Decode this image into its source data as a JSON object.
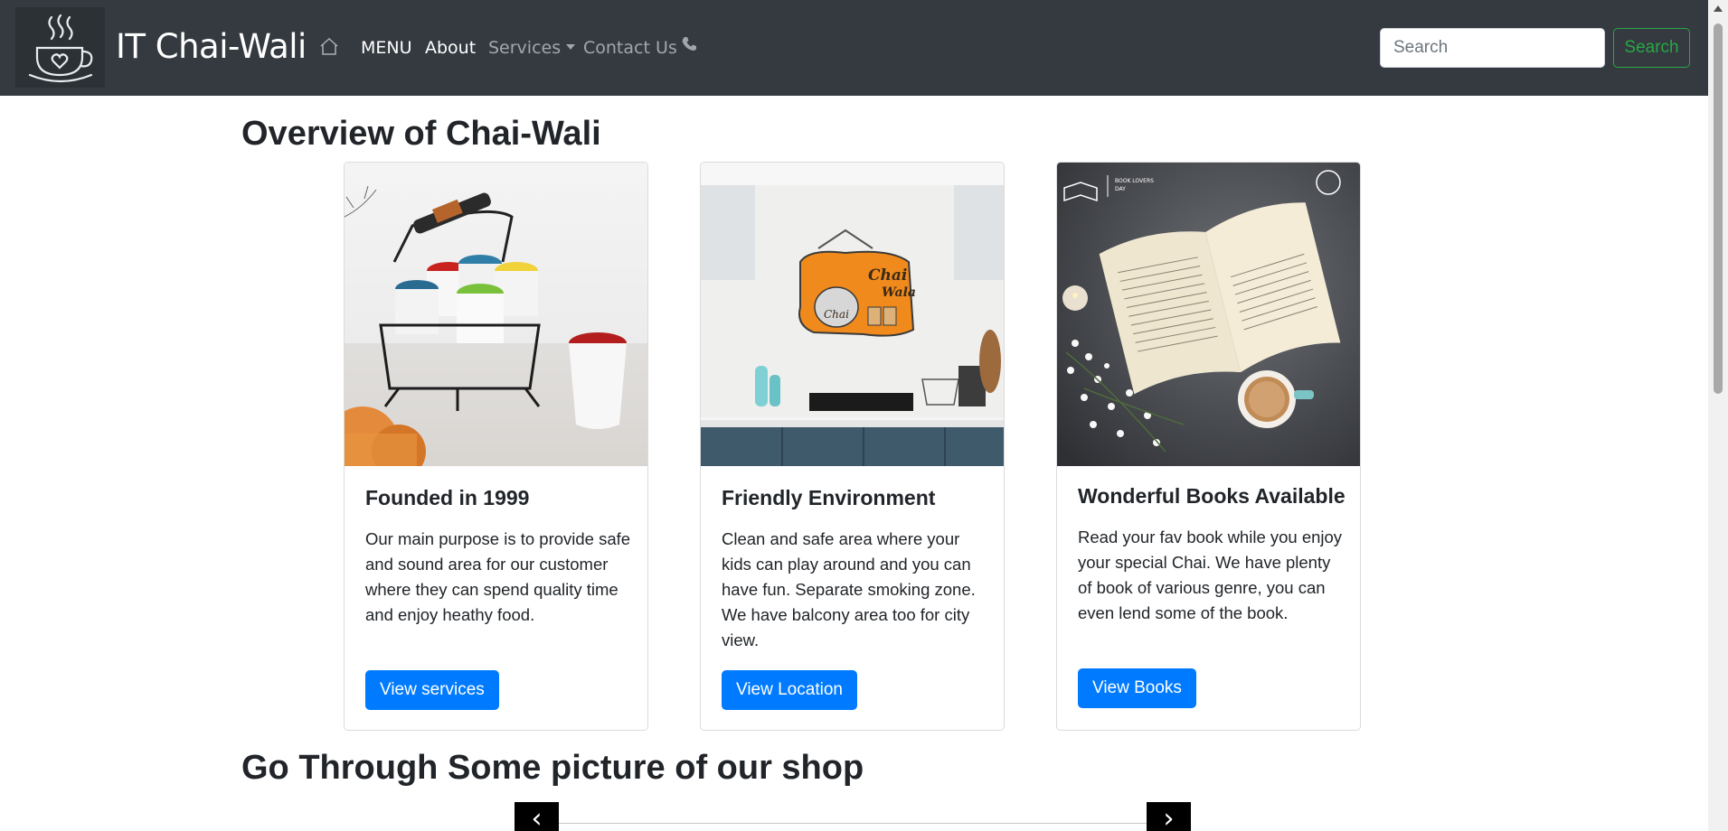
{
  "navbar": {
    "brand": "IT Chai-Wali",
    "menu": "MENU",
    "about": "About",
    "services": "Services",
    "contact": "Contact Us",
    "search_placeholder": "Search",
    "search_button": "Search",
    "icons": [
      "home-icon",
      "chevron-down-icon",
      "phone-icon",
      "chai-cup-logo"
    ]
  },
  "main": {
    "overview_heading": "Overview of Chai-Wali",
    "pictures_heading": "Go Through Some picture of our shop",
    "cards": [
      {
        "title": "Founded in 1999",
        "text": "Our main purpose is to provide safe and sound area for our customer where they can spend quality time and enjoy heathy food.",
        "button": "View services",
        "image": "colorful cups in wire carrier with biscuits"
      },
      {
        "title": "Friendly Environment",
        "text": "Clean and safe area where your kids can play around and you can have fun. Separate smoking zone. We have balcony area too for city view.",
        "button": "View Location",
        "image": "kitchen wall with Chai Wala sign",
        "sign_text": [
          "Chai",
          "Wala",
          "Chai"
        ]
      },
      {
        "title": "Wonderful Books Available",
        "text": "Read your fav book while you enjoy your special Chai. We have plenty of book of various genre, you can even lend some of the book.",
        "button": "View Books",
        "image": "open book with cup of chai and flowers",
        "image_caption": [
          "BOOK LOVERS",
          "DAY"
        ]
      }
    ],
    "carousel": {
      "prev": "‹",
      "next": "›"
    }
  },
  "colors": {
    "navbar_bg": "#343a40",
    "primary": "#007bff",
    "success": "#28a745"
  }
}
